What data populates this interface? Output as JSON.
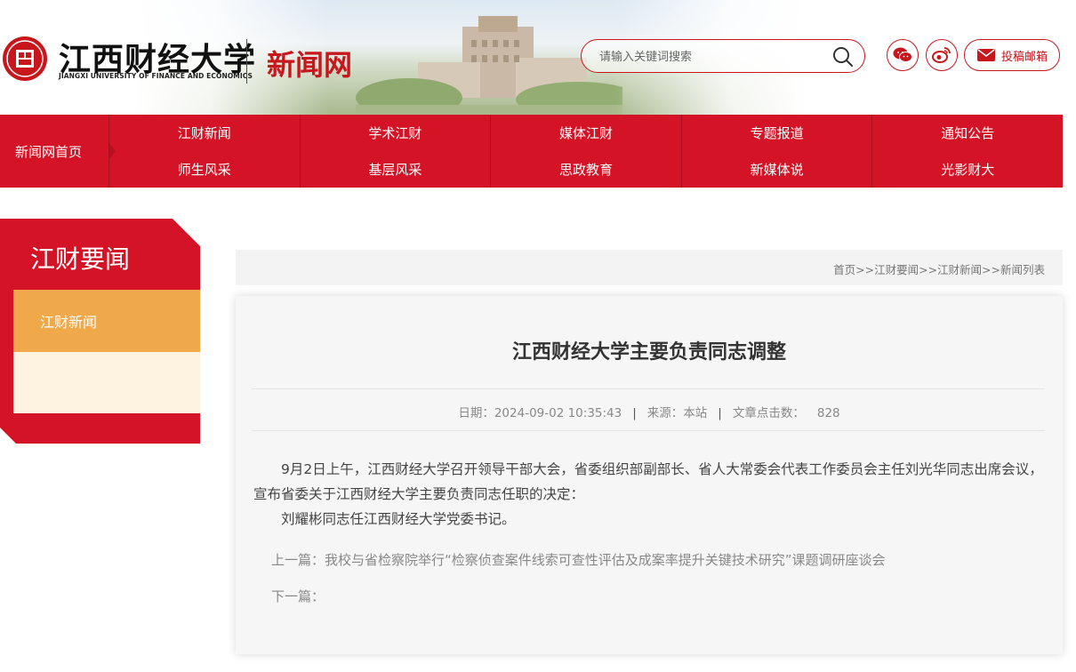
{
  "header": {
    "logo_cn": "江西财经大学",
    "logo_en": "JIANGXI UNIVERSITY OF FINANCE AND ECONOMICS",
    "site_name": "新闻网",
    "search_placeholder": "请输入关键词搜索",
    "icons": [
      "wechat-icon",
      "weibo-icon",
      "search-icon",
      "mail-icon"
    ],
    "submit_label": "投稿邮箱"
  },
  "nav": {
    "home": "新闻网首页",
    "items": [
      "江财新闻",
      "学术江财",
      "媒体江财",
      "专题报道",
      "通知公告",
      "师生风采",
      "基层风采",
      "思政教育",
      "新媒体说",
      "光影财大"
    ]
  },
  "sidebar": {
    "title": "江财要闻",
    "items": [
      "江财新闻"
    ]
  },
  "breadcrumb": "首页>>江财要闻>>江财新闻>>新闻列表",
  "article": {
    "title": "江西财经大学主要负责同志调整",
    "date_label": "日期：",
    "date": "2024-09-02 10:35:43",
    "source_label": "来源：",
    "source": "本站",
    "views_label": "文章点击数：",
    "views": "828",
    "paragraphs": [
      "9月2日上午，江西财经大学召开领导干部大会，省委组织部副部长、省人大常委会代表工作委员会主任刘光华同志出席会议，宣布省委关于江西财经大学主要负责同志任职的决定：",
      "刘耀彬同志任江西财经大学党委书记。"
    ],
    "prev_label": "上一篇：",
    "prev_title": "我校与省检察院举行“检察侦查案件线索可查性评估及成案率提升关键技术研究”课题调研座谈会",
    "next_label": "下一篇：",
    "next_title": ""
  },
  "colors": {
    "brand_red": "#d41426",
    "accent_orange": "#efa94a",
    "pale_cream": "#fdf3e0"
  }
}
